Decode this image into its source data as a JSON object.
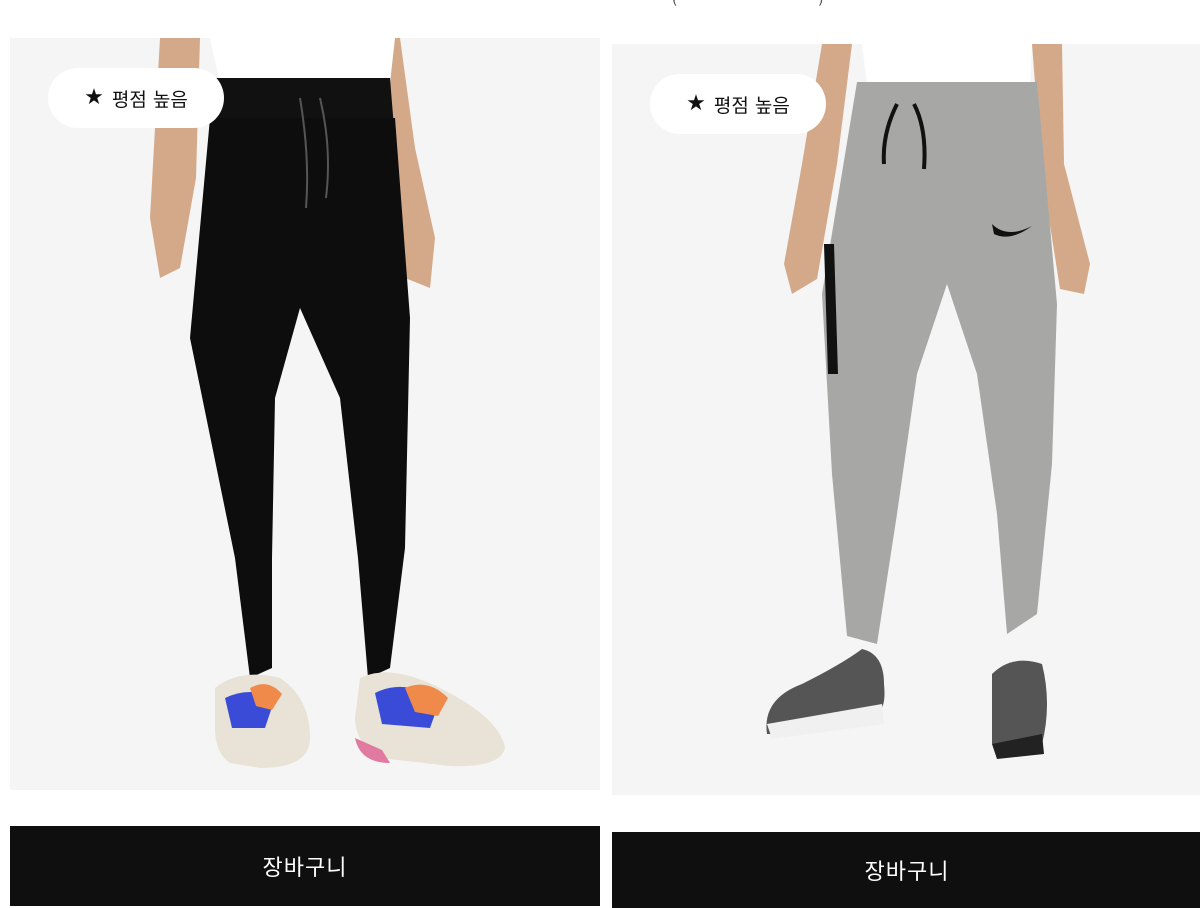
{
  "header": {
    "fragment_left": "(",
    "fragment_right": ")"
  },
  "products": [
    {
      "badge": {
        "icon": "star-icon",
        "star": "★",
        "label": "평점 높음"
      },
      "pants_color": "#0d0d0d",
      "cart_label": "장바구니",
      "thumbnails": [
        {
          "color": "#a9aaa8",
          "selected": false
        },
        {
          "color": "#151515",
          "selected": true
        }
      ]
    },
    {
      "badge": {
        "icon": "star-icon",
        "star": "★",
        "label": "평점 높음"
      },
      "pants_color": "#a7a8a6",
      "cart_label": "장바구니",
      "thumbnails": [
        {
          "color": "#a9aaa8",
          "selected": true
        },
        {
          "color": "#151515",
          "selected": false
        }
      ]
    }
  ]
}
